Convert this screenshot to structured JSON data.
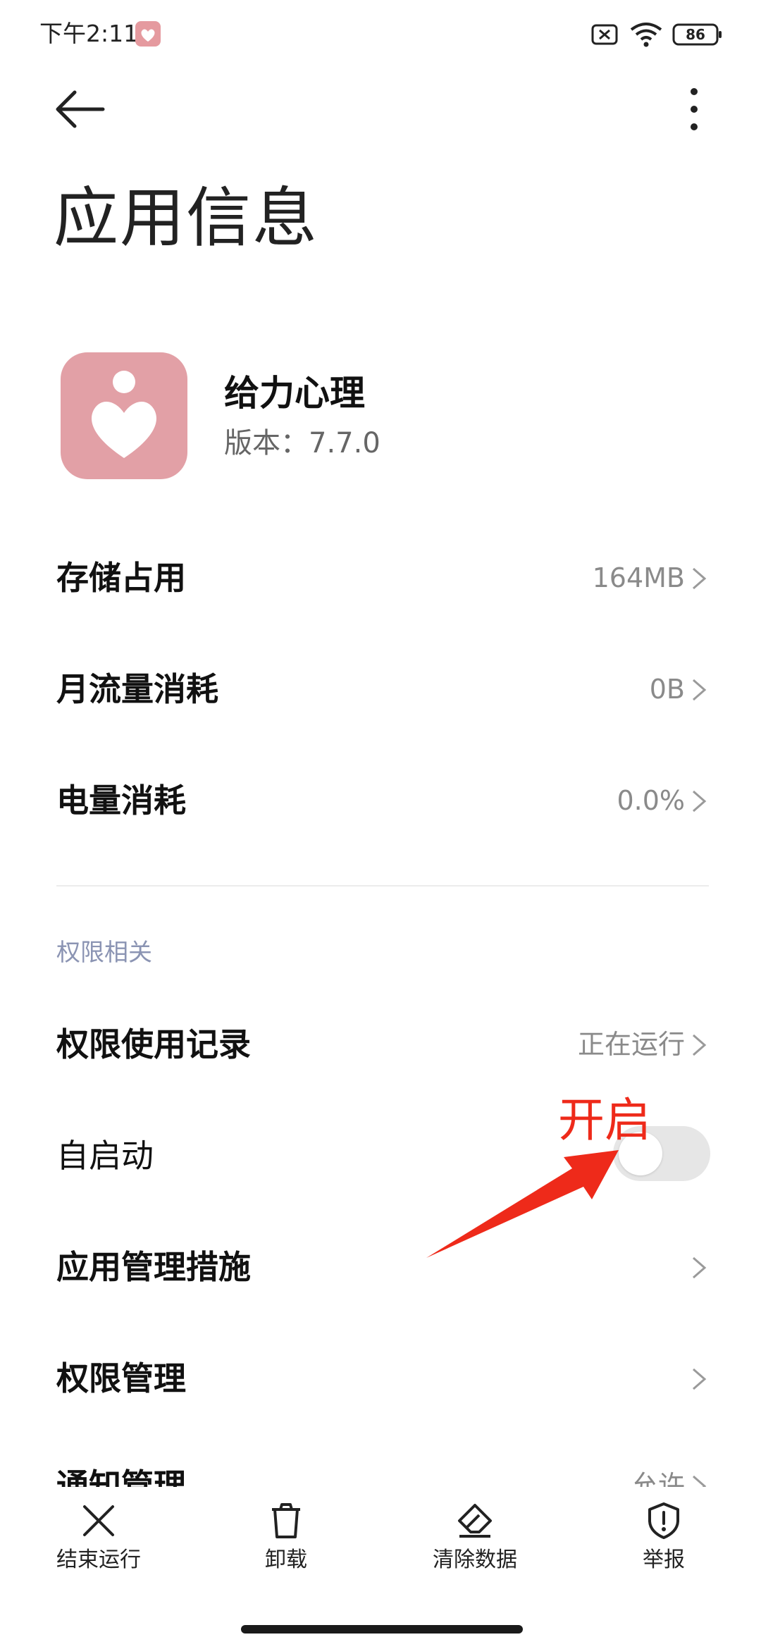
{
  "status_bar": {
    "time": "下午2:11",
    "battery": "86"
  },
  "header": {
    "title": "应用信息"
  },
  "app": {
    "name": "给力心理",
    "version": "版本：7.7.0"
  },
  "rows_top": [
    {
      "label": "存储占用",
      "value": "164MB"
    },
    {
      "label": "月流量消耗",
      "value": "0B"
    },
    {
      "label": "电量消耗",
      "value": "0.0%"
    }
  ],
  "section": {
    "permissions_header": "权限相关"
  },
  "rows_perm": [
    {
      "label": "权限使用记录",
      "value": "正在运行"
    },
    {
      "label": "自启动",
      "toggle_on": false
    },
    {
      "label": "应用管理措施",
      "value": ""
    },
    {
      "label": "权限管理",
      "value": ""
    },
    {
      "label": "通知管理",
      "value": "允许"
    }
  ],
  "annotation": {
    "text": "开启",
    "color": "#ee2a1a"
  },
  "bottom_actions": [
    {
      "label": "结束运行",
      "icon": "close-icon"
    },
    {
      "label": "卸载",
      "icon": "trash-icon"
    },
    {
      "label": "清除数据",
      "icon": "eraser-icon"
    },
    {
      "label": "举报",
      "icon": "shield-alert-icon"
    }
  ],
  "colors": {
    "app_icon": "#e2a0a6",
    "section_header": "#8b94b3",
    "toggle_off": "#e6e6e6"
  }
}
